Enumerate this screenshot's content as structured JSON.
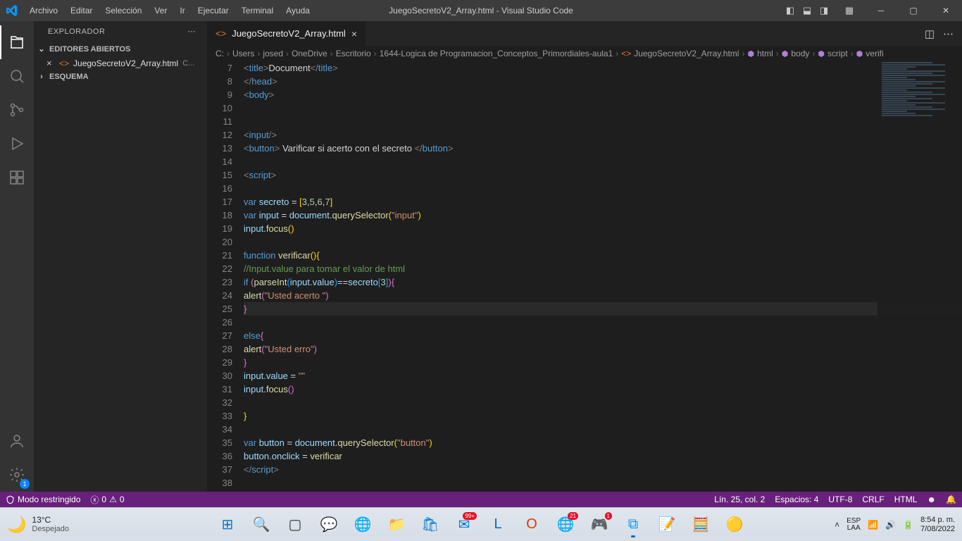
{
  "titlebar": {
    "menu": [
      "Archivo",
      "Editar",
      "Selección",
      "Ver",
      "Ir",
      "Ejecutar",
      "Terminal",
      "Ayuda"
    ],
    "title": "JuegoSecretoV2_Array.html - Visual Studio Code"
  },
  "sidebar": {
    "header": "EXPLORADOR",
    "sections": {
      "openEditors": "EDITORES ABIERTOS",
      "outline": "ESQUEMA"
    },
    "openFile": {
      "name": "JuegoSecretoV2_Array.html",
      "path": "C..."
    }
  },
  "tab": {
    "name": "JuegoSecretoV2_Array.html"
  },
  "breadcrumbs": [
    "C:",
    "Users",
    "josed",
    "OneDrive",
    "Escritorio",
    "1644-Logica de Programacion_Conceptos_Primordiales-aula1",
    "JuegoSecretoV2_Array.html",
    "html",
    "body",
    "script",
    "verifi"
  ],
  "code": {
    "startLine": 7,
    "activeLine": 25,
    "lines": [
      {
        "n": 7,
        "i": 2,
        "seg": [
          [
            "angle",
            "<"
          ],
          [
            "tag",
            "title"
          ],
          [
            "angle",
            ">"
          ],
          [
            "text",
            "Document"
          ],
          [
            "angle",
            "</"
          ],
          [
            "tag",
            "title"
          ],
          [
            "angle",
            ">"
          ]
        ]
      },
      {
        "n": 8,
        "i": 1,
        "seg": [
          [
            "angle",
            "</"
          ],
          [
            "tag",
            "head"
          ],
          [
            "angle",
            ">"
          ]
        ]
      },
      {
        "n": 9,
        "i": 1,
        "seg": [
          [
            "angle",
            "<"
          ],
          [
            "tag",
            "body"
          ],
          [
            "angle",
            ">"
          ]
        ]
      },
      {
        "n": 10,
        "i": 0,
        "seg": []
      },
      {
        "n": 11,
        "i": 0,
        "seg": []
      },
      {
        "n": 12,
        "i": 1,
        "seg": [
          [
            "angle",
            "<"
          ],
          [
            "tag",
            "input"
          ],
          [
            "angle",
            "/>"
          ]
        ]
      },
      {
        "n": 13,
        "i": 1,
        "seg": [
          [
            "angle",
            "<"
          ],
          [
            "tag",
            "button"
          ],
          [
            "angle",
            ">"
          ],
          [
            "text",
            " Varificar si acerto con el secreto "
          ],
          [
            "angle",
            "</"
          ],
          [
            "tag",
            "button"
          ],
          [
            "angle",
            ">"
          ]
        ]
      },
      {
        "n": 14,
        "i": 0,
        "seg": []
      },
      {
        "n": 15,
        "i": 1,
        "seg": [
          [
            "angle",
            "<"
          ],
          [
            "tag",
            "script"
          ],
          [
            "angle",
            ">"
          ]
        ]
      },
      {
        "n": 16,
        "i": 0,
        "seg": []
      },
      {
        "n": 17,
        "i": 1,
        "seg": [
          [
            "kw",
            "var"
          ],
          [
            "text",
            " "
          ],
          [
            "var",
            "secreto"
          ],
          [
            "text",
            " "
          ],
          [
            "op",
            "="
          ],
          [
            "text",
            " "
          ],
          [
            "br",
            "["
          ],
          [
            "num",
            "3"
          ],
          [
            "punc",
            ","
          ],
          [
            "num",
            "5"
          ],
          [
            "punc",
            ","
          ],
          [
            "num",
            "6"
          ],
          [
            "punc",
            ","
          ],
          [
            "num",
            "7"
          ],
          [
            "br",
            "]"
          ]
        ]
      },
      {
        "n": 18,
        "i": 1,
        "seg": [
          [
            "kw",
            "var"
          ],
          [
            "text",
            " "
          ],
          [
            "var",
            "input"
          ],
          [
            "text",
            " "
          ],
          [
            "op",
            "="
          ],
          [
            "text",
            " "
          ],
          [
            "var",
            "document"
          ],
          [
            "punc",
            "."
          ],
          [
            "fn",
            "querySelector"
          ],
          [
            "br",
            "("
          ],
          [
            "str",
            "\"input\""
          ],
          [
            "br",
            ")"
          ]
        ]
      },
      {
        "n": 19,
        "i": 1,
        "seg": [
          [
            "var",
            "input"
          ],
          [
            "punc",
            "."
          ],
          [
            "fn",
            "focus"
          ],
          [
            "br",
            "()"
          ]
        ]
      },
      {
        "n": 20,
        "i": 0,
        "seg": []
      },
      {
        "n": 21,
        "i": 1,
        "seg": [
          [
            "kw",
            "function"
          ],
          [
            "text",
            " "
          ],
          [
            "fn",
            "verificar"
          ],
          [
            "br",
            "()"
          ],
          [
            "br",
            "{"
          ]
        ]
      },
      {
        "n": 22,
        "i": 2,
        "seg": [
          [
            "cmt",
            "//Input.value para tomar el valor de html"
          ]
        ]
      },
      {
        "n": 23,
        "i": 2,
        "seg": [
          [
            "kw",
            "if"
          ],
          [
            "text",
            " "
          ],
          [
            "br2",
            "("
          ],
          [
            "fn",
            "parseInt"
          ],
          [
            "br3",
            "("
          ],
          [
            "var",
            "input"
          ],
          [
            "punc",
            "."
          ],
          [
            "var",
            "value"
          ],
          [
            "br3",
            ")"
          ],
          [
            "op",
            "=="
          ],
          [
            "var",
            "secreto"
          ],
          [
            "br3",
            "["
          ],
          [
            "num",
            "3"
          ],
          [
            "br3",
            "]"
          ],
          [
            "br2",
            ")"
          ],
          [
            "br2",
            "{"
          ]
        ]
      },
      {
        "n": 24,
        "i": 2,
        "seg": [
          [
            "fn",
            "alert"
          ],
          [
            "br2",
            "("
          ],
          [
            "str",
            "\"Usted acerto \""
          ],
          [
            "br2",
            ")"
          ]
        ]
      },
      {
        "n": 25,
        "i": 1,
        "seg": [
          [
            "br2",
            "}"
          ]
        ]
      },
      {
        "n": 26,
        "i": 0,
        "seg": []
      },
      {
        "n": 27,
        "i": 2,
        "seg": [
          [
            "kw",
            "else"
          ],
          [
            "br2",
            "{"
          ]
        ]
      },
      {
        "n": 28,
        "i": 2,
        "seg": [
          [
            "fn",
            "alert"
          ],
          [
            "br2",
            "("
          ],
          [
            "str",
            "\"Usted erro\""
          ],
          [
            "br2",
            ")"
          ]
        ]
      },
      {
        "n": 29,
        "i": 1,
        "seg": [
          [
            "br2",
            "}"
          ]
        ]
      },
      {
        "n": 30,
        "i": 2,
        "seg": [
          [
            "var",
            "input"
          ],
          [
            "punc",
            "."
          ],
          [
            "var",
            "value"
          ],
          [
            "text",
            " "
          ],
          [
            "op",
            "="
          ],
          [
            "text",
            " "
          ],
          [
            "str",
            "\"\""
          ]
        ]
      },
      {
        "n": 31,
        "i": 2,
        "seg": [
          [
            "var",
            "input"
          ],
          [
            "punc",
            "."
          ],
          [
            "fn",
            "focus"
          ],
          [
            "br2",
            "()"
          ]
        ]
      },
      {
        "n": 32,
        "i": 0,
        "seg": []
      },
      {
        "n": 33,
        "i": 1,
        "seg": [
          [
            "br",
            "}"
          ]
        ]
      },
      {
        "n": 34,
        "i": 0,
        "seg": []
      },
      {
        "n": 35,
        "i": 1,
        "seg": [
          [
            "kw",
            "var"
          ],
          [
            "text",
            " "
          ],
          [
            "var",
            "button"
          ],
          [
            "text",
            " "
          ],
          [
            "op",
            "="
          ],
          [
            "text",
            " "
          ],
          [
            "var",
            "document"
          ],
          [
            "punc",
            "."
          ],
          [
            "fn",
            "querySelector"
          ],
          [
            "br",
            "("
          ],
          [
            "str",
            "\"button\""
          ],
          [
            "br",
            ")"
          ]
        ]
      },
      {
        "n": 36,
        "i": 1,
        "seg": [
          [
            "var",
            "button"
          ],
          [
            "punc",
            "."
          ],
          [
            "var",
            "onclick"
          ],
          [
            "text",
            " "
          ],
          [
            "op",
            "="
          ],
          [
            "text",
            " "
          ],
          [
            "fn",
            "verificar"
          ]
        ]
      },
      {
        "n": 37,
        "i": 1,
        "seg": [
          [
            "angle",
            "</"
          ],
          [
            "tag",
            "script"
          ],
          [
            "angle",
            ">"
          ]
        ]
      },
      {
        "n": 38,
        "i": 0,
        "seg": []
      }
    ]
  },
  "statusbar": {
    "restricted": "Modo restringido",
    "errors": "0",
    "warnings": "0",
    "line_col": "Lín. 25, col. 2",
    "spaces": "Espacios: 4",
    "encoding": "UTF-8",
    "eol": "CRLF",
    "lang": "HTML"
  },
  "taskbar": {
    "temp": "13°C",
    "weather": "Despejado",
    "lang1": "ESP",
    "lang2": "LAA",
    "time": "8:54 p. m.",
    "date": "7/08/2022",
    "apps": [
      {
        "name": "start",
        "color": "#0078d4",
        "glyph": "⊞"
      },
      {
        "name": "search",
        "color": "#333",
        "glyph": "🔍"
      },
      {
        "name": "taskview",
        "color": "#333",
        "glyph": "▢"
      },
      {
        "name": "chat",
        "color": "#6264a7",
        "glyph": "💬"
      },
      {
        "name": "edge",
        "color": "#0078d4",
        "glyph": "🌐"
      },
      {
        "name": "explorer",
        "color": "#ffb900",
        "glyph": "📁"
      },
      {
        "name": "store",
        "color": "#0078d4",
        "glyph": "🛍"
      },
      {
        "name": "mail",
        "color": "#0078d4",
        "glyph": "✉",
        "badge": "99+"
      },
      {
        "name": "linkedin",
        "color": "#0a66c2",
        "glyph": "L"
      },
      {
        "name": "office",
        "color": "#d83b01",
        "glyph": "O"
      },
      {
        "name": "edge2",
        "color": "#0078d4",
        "glyph": "🌐",
        "badge": "21"
      },
      {
        "name": "discord",
        "color": "#5865f2",
        "glyph": "🎮",
        "badge": "1"
      },
      {
        "name": "vscode",
        "color": "#0098ff",
        "glyph": "⧉",
        "active": true
      },
      {
        "name": "notepad",
        "color": "#4db6e2",
        "glyph": "📝"
      },
      {
        "name": "calc",
        "color": "#333",
        "glyph": "🧮"
      },
      {
        "name": "chrome",
        "color": "#ea4335",
        "glyph": "🟡"
      }
    ]
  }
}
